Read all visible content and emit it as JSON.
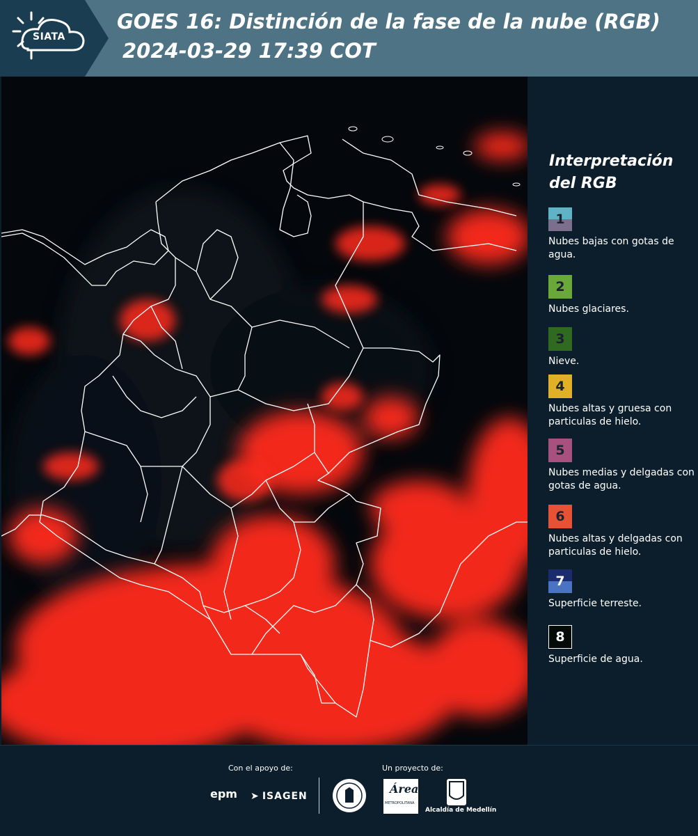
{
  "header": {
    "logo_text": "SIATA",
    "title_line1": "GOES 16: Distinción de la fase de la nube (RGB)",
    "title_line2": "2024-03-29 17:39 COT"
  },
  "legend": {
    "title": "Interpretación del RGB",
    "items": [
      {
        "number": "1",
        "label": "Nubes bajas con gotas de agua.",
        "color_top": "#5fb3c4",
        "color_bottom": "#7c6f8e"
      },
      {
        "number": "2",
        "label": "Nubes glaciares.",
        "color": "#6aa83a"
      },
      {
        "number": "3",
        "label": "Nieve.",
        "color": "#2f6a20"
      },
      {
        "number": "4",
        "label": "Nubes altas y gruesa con particulas de hielo.",
        "color": "#e0b126"
      },
      {
        "number": "5",
        "label": "Nubes medias y delgadas con gotas de agua.",
        "color": "#a8507e"
      },
      {
        "number": "6",
        "label": "Nubes altas y delgadas con particulas de hielo.",
        "color": "#e65233"
      },
      {
        "number": "7",
        "label": "Superficie terreste.",
        "color_top": "#1a2b6e",
        "color_bottom": "#4a73c4",
        "text_color": "#ffffff"
      },
      {
        "number": "8",
        "label": "Superficie de agua.",
        "color": "#040a08",
        "text_color": "#ffffff",
        "border": "#ffffff"
      }
    ]
  },
  "footer": {
    "support_caption": "Con el apoyo de:",
    "project_caption": "Un proyecto de:",
    "sponsor1": "epm",
    "sponsor2": "ISAGEN",
    "partner_area": "METROPOLITANA",
    "partner_alcaldia": "Alcaldía de Medellín"
  },
  "colors": {
    "header_bg": "#4e7385",
    "page_bg": "#0c1e2b",
    "cloud_red": "#ff2a1a",
    "border_lines": "#ffffff"
  }
}
